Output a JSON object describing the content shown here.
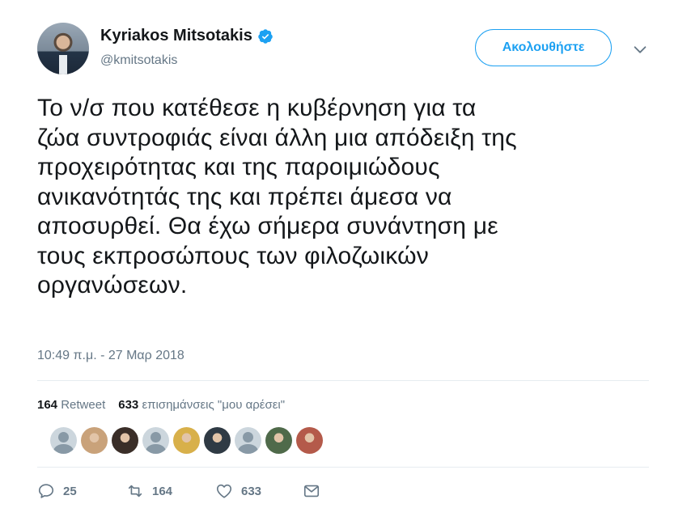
{
  "author": {
    "name": "Kyriakos Mitsotakis",
    "handle": "@kmitsotakis",
    "verified_icon": "verified-badge-icon"
  },
  "header": {
    "follow_label": "Ακολουθήστε",
    "menu_icon": "chevron-down-icon"
  },
  "tweet": {
    "text": "Το ν/σ που κατέθεσε η κυβέρνηση για τα\nζώα συντροφιάς είναι άλλη μια απόδειξη της\nπροχειρότητας και της παροιμιώδους\nανικανότητάς της και πρέπει άμεσα να\nαποσυρθεί. Θα έχω σήμερα συνάντηση με\nτους εκπροσώπους των φιλοζωικών\nοργανώσεων.",
    "timestamp": "10:49 π.μ. - 27 Μαρ 2018"
  },
  "stats": {
    "retweets_count": "164",
    "retweets_label": "Retweet",
    "likes_count": "633",
    "likes_label": "επισημάνσεις \"μου αρέσει\""
  },
  "likers": [
    {
      "icon": "default-avatar",
      "color": "#ccd6dd"
    },
    {
      "icon": "user-photo",
      "color": "#c9a27a"
    },
    {
      "icon": "user-photo",
      "color": "#3a2e28"
    },
    {
      "icon": "default-avatar",
      "color": "#ccd6dd"
    },
    {
      "icon": "user-photo",
      "color": "#d8b04a"
    },
    {
      "icon": "user-photo",
      "color": "#2f3a44"
    },
    {
      "icon": "default-avatar",
      "color": "#ccd6dd"
    },
    {
      "icon": "user-photo",
      "color": "#4f6a4a"
    },
    {
      "icon": "user-photo",
      "color": "#b45a4a"
    }
  ],
  "actions": {
    "reply_count": "25",
    "retweet_count": "164",
    "like_count": "633"
  },
  "colors": {
    "accent": "#1da1f2",
    "muted": "#657786",
    "divider": "#e6ecf0"
  }
}
